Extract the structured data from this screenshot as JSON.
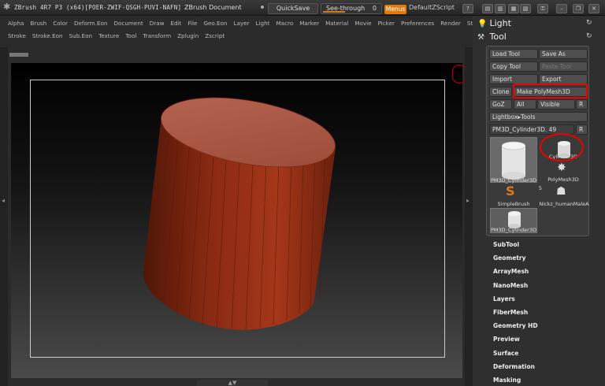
{
  "titlebar": {
    "title": "ZBrush 4R7 P3 (x64)[POER-ZWIF-QSGH-PUVI-NAFN]",
    "document": "ZBrush Document",
    "quicksave": "QuickSave",
    "seethrough_label": "See-through",
    "seethrough_value": "0",
    "menus": "Menus",
    "default_zscript": "DefaultZScript"
  },
  "menubar": {
    "row1": [
      "Alpha",
      "Brush",
      "Color",
      "Deform.Eon",
      "Document",
      "Draw",
      "Edit",
      "File",
      "Geo.Eon",
      "Layer",
      "Light",
      "Macro",
      "Marker",
      "Material",
      "Movie",
      "Picker",
      "Preferences",
      "Render",
      "Stencil"
    ],
    "row2": [
      "Stroke",
      "Stroke.Eon",
      "Sub.Eon",
      "Texture",
      "Tool",
      "Transform",
      "Zplugin",
      "Zscript"
    ]
  },
  "rpanel": {
    "light_label": "Light",
    "tool_label": "Tool",
    "buttons": {
      "load_tool": "Load Tool",
      "save_as": "Save As",
      "copy_tool": "Copy Tool",
      "paste_tool": "Paste Tool",
      "import": "Import",
      "export": "Export",
      "clone": "Clone",
      "make_polymesh": "Make PolyMesh3D",
      "goz": "GoZ",
      "all": "All",
      "visible": "Visible",
      "r1": "R",
      "lightbox_tools": "Lightbox▸Tools",
      "current_tool": "PM3D_Cylinder3D. 49",
      "r2": "R"
    },
    "thumbs": {
      "big_caption": "PM3D_Cylinder3D",
      "cylinder": "Cylinder3D",
      "polymesh": "PolyMesh3D",
      "simplebrush": "SimpleBrush",
      "count": "5",
      "nickz": "Nickz_humanMaleA",
      "small_caption": "PM3D_Cylinder3D"
    },
    "subpalettes": [
      "SubTool",
      "Geometry",
      "ArrayMesh",
      "NanoMesh",
      "Layers",
      "FiberMesh",
      "Geometry HD",
      "Preview",
      "Surface",
      "Deformation",
      "Masking"
    ]
  },
  "colors": {
    "accent": "#e07a10",
    "highlight": "#e00000",
    "mesh": "#8a2e16"
  }
}
